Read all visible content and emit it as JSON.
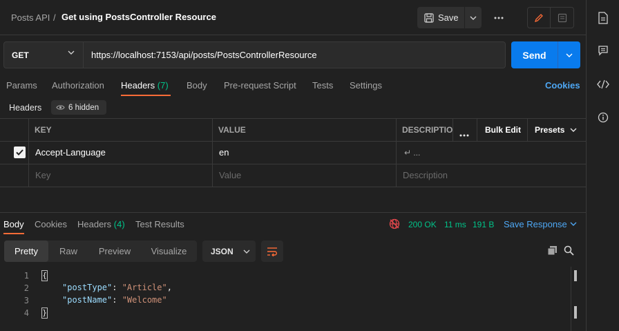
{
  "header": {
    "collection": "Posts API",
    "separator": "/",
    "request_title": "Get using PostsController Resource",
    "save_label": "Save",
    "more_label": "ooo"
  },
  "request": {
    "method": "GET",
    "url": "https://localhost:7153/api/posts/PostsControllerResource",
    "send_label": "Send"
  },
  "request_tabs": [
    {
      "label": "Params"
    },
    {
      "label": "Authorization"
    },
    {
      "label": "Headers",
      "count": "(7)",
      "active": true
    },
    {
      "label": "Body"
    },
    {
      "label": "Pre-request Script"
    },
    {
      "label": "Tests"
    },
    {
      "label": "Settings"
    }
  ],
  "cookies_label": "Cookies",
  "headers_panel": {
    "label": "Headers",
    "hidden_label": "6 hidden",
    "columns": {
      "key": "KEY",
      "value": "VALUE",
      "description": "DESCRIPTIO",
      "more": "ooo",
      "bulk_edit": "Bulk Edit",
      "presets": "Presets"
    },
    "rows": [
      {
        "checked": true,
        "key": "Accept-Language",
        "value": "en",
        "description": "↵ ..."
      }
    ],
    "placeholders": {
      "key": "Key",
      "value": "Value",
      "description": "Description"
    }
  },
  "response": {
    "tabs": [
      {
        "label": "Body",
        "active": true
      },
      {
        "label": "Cookies"
      },
      {
        "label": "Headers",
        "count": "(4)"
      },
      {
        "label": "Test Results"
      }
    ],
    "status": "200 OK",
    "time": "11 ms",
    "size": "191 B",
    "save_response_label": "Save Response",
    "view_modes": [
      "Pretty",
      "Raw",
      "Preview",
      "Visualize"
    ],
    "format": "JSON",
    "body_lines": [
      {
        "n": "1",
        "text": "{"
      },
      {
        "n": "2",
        "key": "\"postType\"",
        "value": "\"Article\"",
        "trail": ","
      },
      {
        "n": "3",
        "key": "\"postName\"",
        "value": "\"Welcome\"",
        "trail": ""
      },
      {
        "n": "4",
        "text": "}"
      }
    ]
  },
  "colors": {
    "accent_orange": "#ff6c37",
    "send_blue": "#097bed",
    "status_green": "#00c389",
    "link_blue": "#4ea8f5"
  }
}
